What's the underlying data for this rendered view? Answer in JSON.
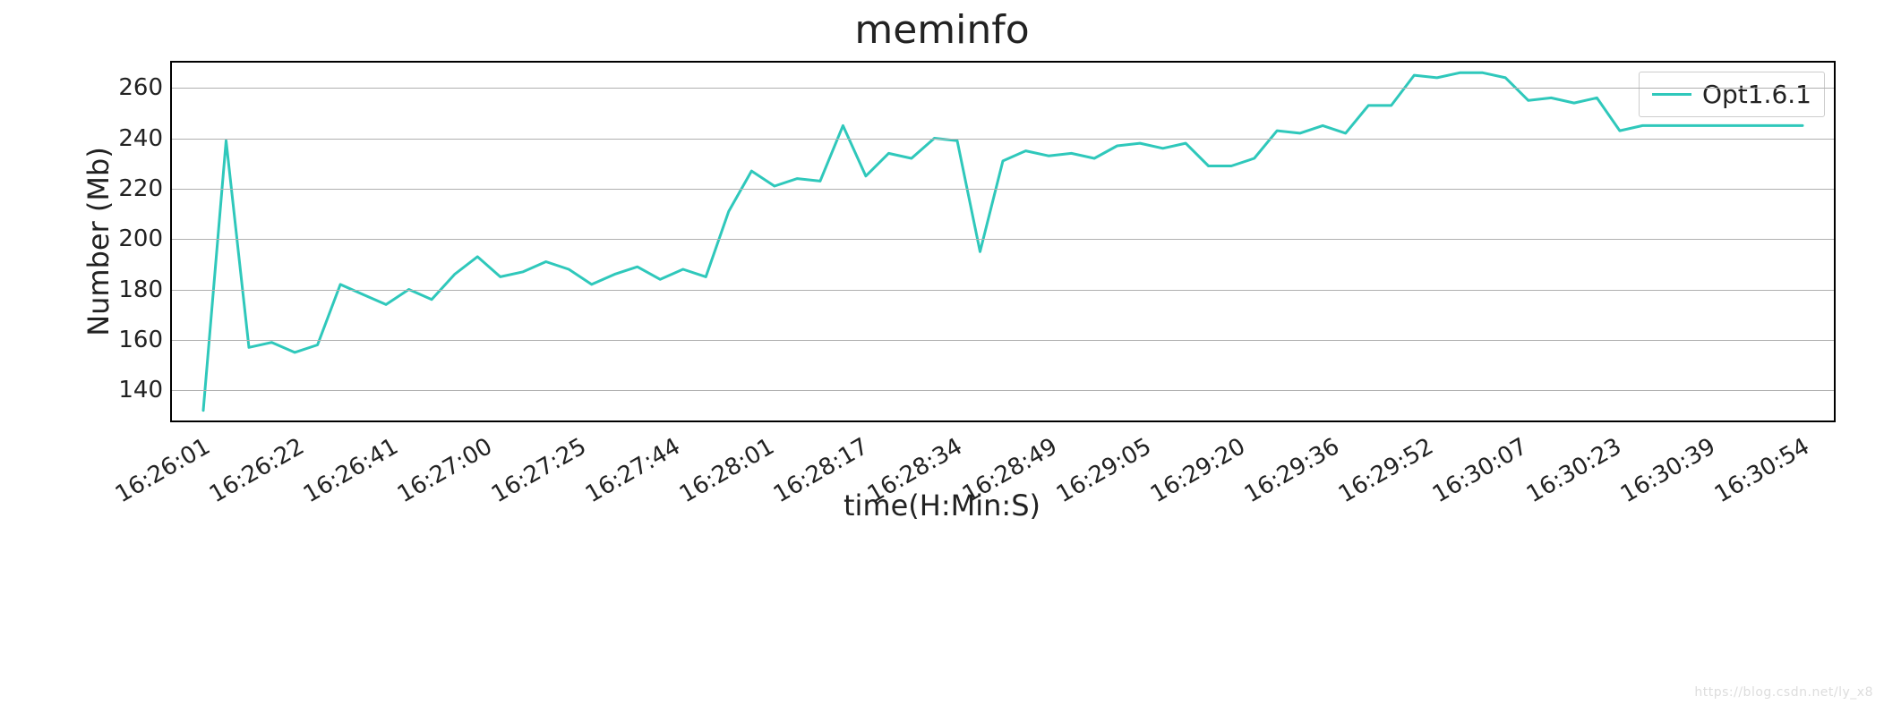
{
  "chart_data": {
    "type": "line",
    "title": "meminfo",
    "xlabel": "time(H:Min:S)",
    "ylabel": "Number (Mb)",
    "ylim": [
      128,
      270
    ],
    "yticks": [
      140,
      160,
      180,
      200,
      220,
      240,
      260
    ],
    "xticks": [
      "16:26:01",
      "16:26:22",
      "16:26:41",
      "16:27:00",
      "16:27:25",
      "16:27:44",
      "16:28:01",
      "16:28:17",
      "16:28:34",
      "16:28:49",
      "16:29:05",
      "16:29:20",
      "16:29:36",
      "16:29:52",
      "16:30:07",
      "16:30:23",
      "16:30:39",
      "16:30:54"
    ],
    "series": [
      {
        "name": "Opt1.6.1",
        "color": "#2fc8bb",
        "values": [
          132,
          239,
          157,
          159,
          155,
          158,
          182,
          178,
          174,
          180,
          176,
          186,
          193,
          185,
          187,
          191,
          188,
          182,
          186,
          189,
          184,
          188,
          185,
          211,
          227,
          221,
          224,
          223,
          245,
          225,
          234,
          232,
          240,
          239,
          195,
          231,
          235,
          233,
          234,
          232,
          237,
          238,
          236,
          238,
          229,
          229,
          232,
          243,
          242,
          245,
          242,
          253,
          253,
          265,
          264,
          266,
          266,
          264,
          255,
          256,
          254,
          256,
          243,
          245,
          245,
          245,
          245,
          245,
          245,
          245,
          245
        ]
      }
    ],
    "legend": {
      "position": "upper-right"
    }
  },
  "watermark": "https://blog.csdn.net/ly_x8"
}
